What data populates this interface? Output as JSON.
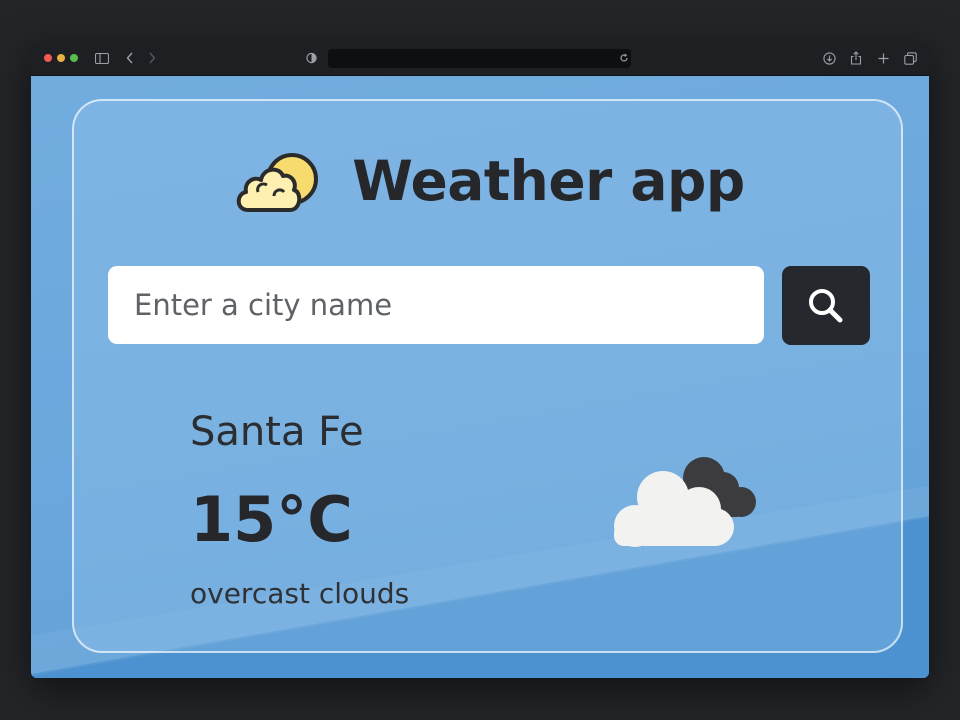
{
  "browser": {
    "icons": [
      "close-dot",
      "minimize-dot",
      "maximize-dot",
      "sidebar-icon",
      "back-icon",
      "forward-icon",
      "privacy-shield-icon",
      "reload-icon",
      "download-icon",
      "share-icon",
      "new-tab-icon",
      "tabs-overview-icon"
    ],
    "url": ""
  },
  "app": {
    "title": "Weather app",
    "title_icon": "cloud-sun-icon"
  },
  "search": {
    "placeholder": "Enter a city name",
    "value": "",
    "button_icon": "search-icon"
  },
  "weather": {
    "city": "Santa Fe",
    "temperature": "15°C",
    "description": "overcast clouds",
    "icon": "overcast-clouds-icon"
  },
  "colors": {
    "background": "#6aa7dc",
    "card_border": "#ffffff",
    "search_button": "#25282c",
    "text": "#25272b"
  }
}
